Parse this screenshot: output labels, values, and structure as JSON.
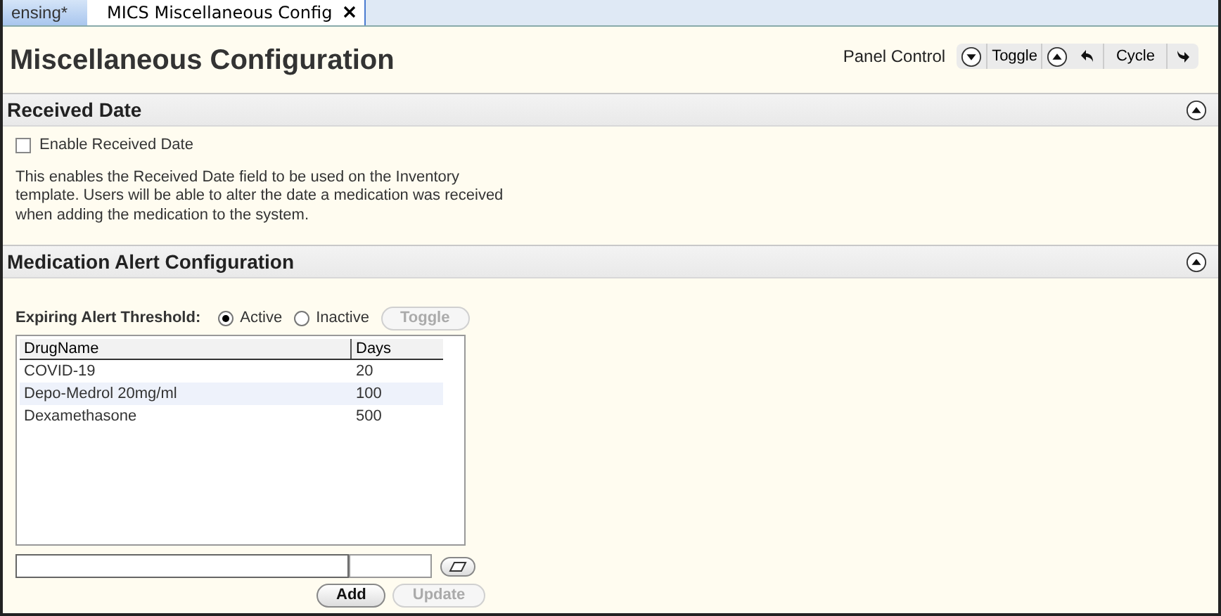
{
  "tabs": [
    {
      "label": "ensing*",
      "selected": false,
      "closable": false
    },
    {
      "label": "MICS Miscellaneous Config",
      "selected": true,
      "closable": true
    }
  ],
  "page_title": "Miscellaneous Configuration",
  "panel_control": {
    "label": "Panel Control",
    "toggle": "Toggle",
    "cycle": "Cycle"
  },
  "received_date": {
    "title": "Received Date",
    "expanded": true,
    "checkbox": {
      "label": "Enable Received Date",
      "checked": false
    },
    "description": "This enables the Received Date field to be used on the Inventory template. Users will be able to alter the date a medication was received when adding the medication to the system."
  },
  "medication_alert": {
    "title": "Medication Alert Configuration",
    "expanded": true,
    "threshold_label": "Expiring Alert Threshold:",
    "options": [
      {
        "label": "Active",
        "selected": true
      },
      {
        "label": "Inactive",
        "selected": false
      }
    ],
    "toggle_button": {
      "label": "Toggle",
      "disabled": true
    },
    "table": {
      "columns": [
        "DrugName",
        "Days"
      ],
      "rows": [
        {
          "cells": [
            "COVID-19",
            "20"
          ],
          "selected": false
        },
        {
          "cells": [
            "Depo-Medrol 20mg/ml",
            "100"
          ],
          "selected": true
        },
        {
          "cells": [
            "Dexamethasone",
            "500"
          ],
          "selected": false
        }
      ]
    },
    "add_button": {
      "label": "Add",
      "disabled": false
    },
    "update_button": {
      "label": "Update",
      "disabled": true
    }
  }
}
